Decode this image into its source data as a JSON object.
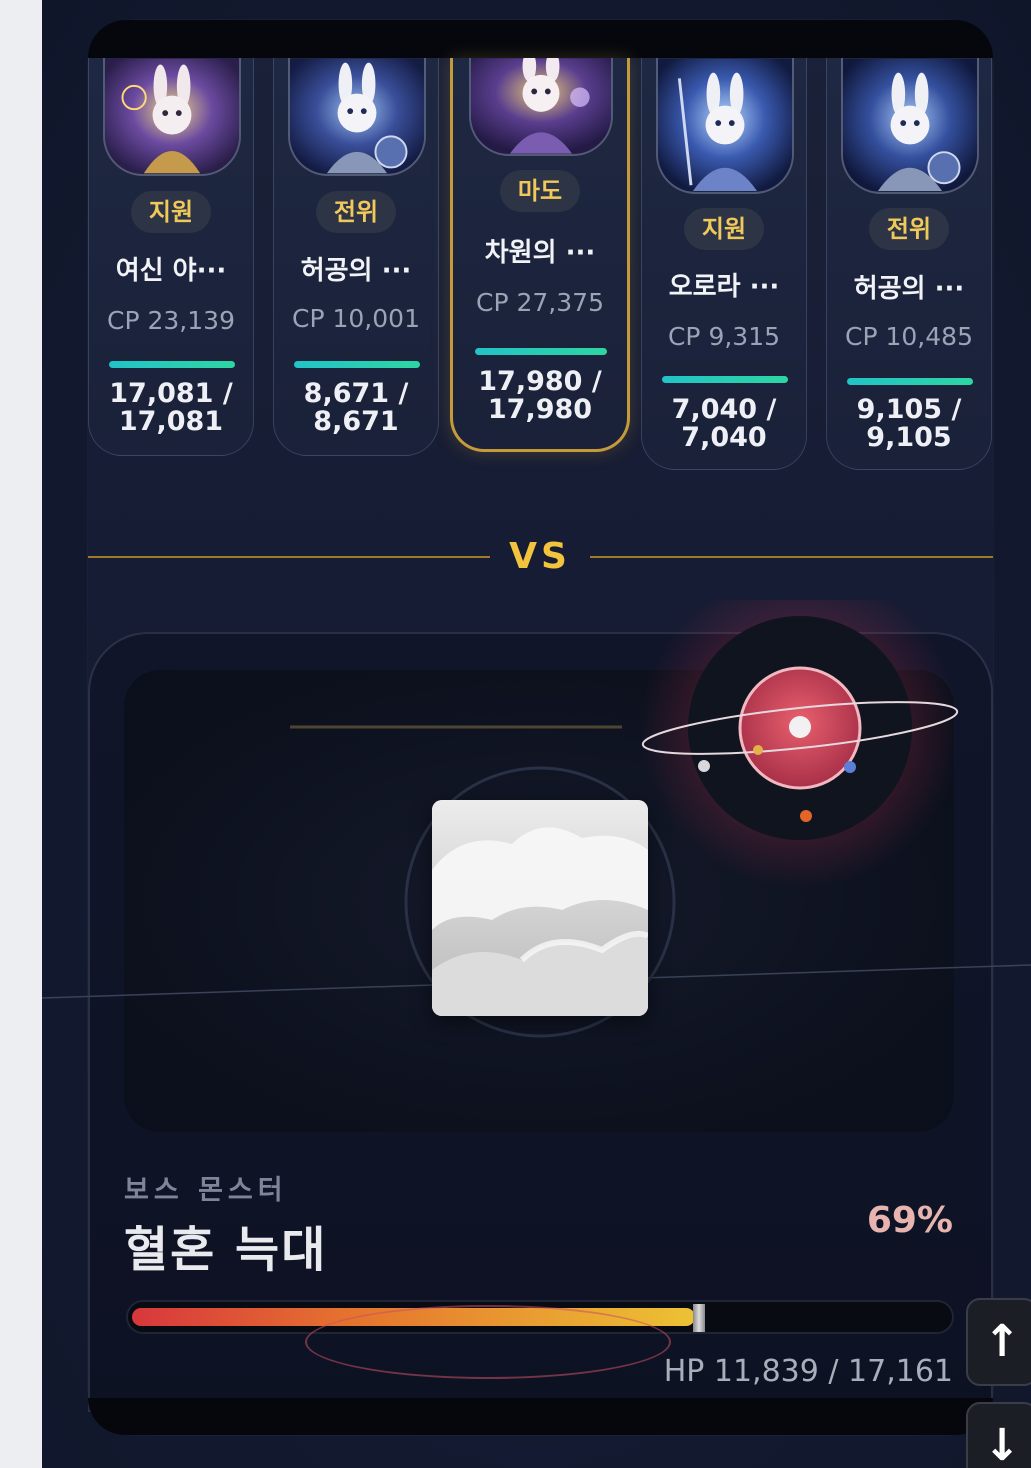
{
  "party": [
    {
      "role": "지원",
      "name": "여신 야···",
      "cp": "CP 23,139",
      "hp": "17,081 /",
      "hp_max": "17,081",
      "hp_ratio": 1.0,
      "selected": false
    },
    {
      "role": "전위",
      "name": "허공의 ···",
      "cp": "CP 10,001",
      "hp": "8,671 /",
      "hp_max": "8,671",
      "hp_ratio": 1.0,
      "selected": false
    },
    {
      "role": "마도",
      "name": "차원의 ···",
      "cp": "CP 27,375",
      "hp": "17,980 /",
      "hp_max": "17,980",
      "hp_ratio": 1.0,
      "selected": true
    },
    {
      "role": "지원",
      "name": "오로라 ···",
      "cp": "CP 9,315",
      "hp": "7,040 /",
      "hp_max": "7,040",
      "hp_ratio": 1.0,
      "selected": false
    },
    {
      "role": "전위",
      "name": "허공의 ···",
      "cp": "CP 10,485",
      "hp": "9,105 /",
      "hp_max": "9,105",
      "hp_ratio": 1.0,
      "selected": false
    }
  ],
  "vs_label": "VS",
  "boss": {
    "label": "보스 몬스터",
    "name": "혈혼 늑대",
    "hp_percent": "69%",
    "hp_text": "HP 11,839 / 17,161",
    "hp_ratio": 0.69
  },
  "controls": {
    "scroll_up": "↑",
    "scroll_down": "↓"
  },
  "colors": {
    "accent_gold": "#f3c33d",
    "role_text": "#f0c95a",
    "hp_teal": "#22c3c7",
    "boss_hp_start": "#d8373d",
    "boss_hp_end": "#ecc234"
  }
}
